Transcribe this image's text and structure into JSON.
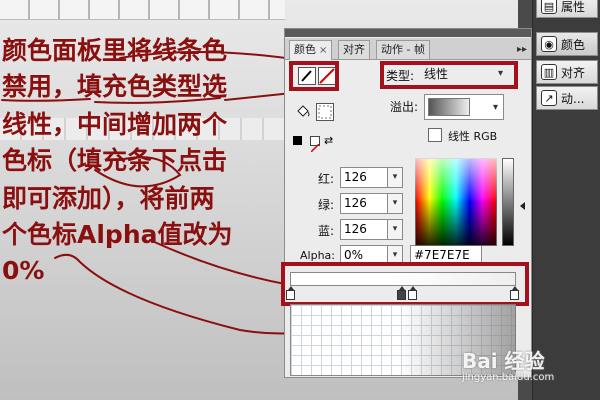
{
  "annotation": {
    "lines": [
      "颜色面板里将线条色",
      "禁用，填充色类型选",
      "线性，中间增加两个",
      "色标（填充条下点击",
      "即可添加），将前两",
      "个色标Alpha值改为",
      "0%"
    ],
    "color": "#8a0f0f"
  },
  "dock": {
    "items": [
      {
        "label": "属性",
        "icon": "properties-icon"
      },
      {
        "label": "颜色",
        "icon": "color-palette-icon"
      },
      {
        "label": "对齐",
        "icon": "align-icon"
      },
      {
        "label": "动...",
        "icon": "motion-icon"
      }
    ]
  },
  "panel": {
    "tabs": [
      {
        "label": "颜色",
        "close": "×"
      },
      {
        "label": "对齐"
      },
      {
        "label": "动作 - 帧"
      }
    ],
    "menu_glyph": "▸▸",
    "type_label": "类型:",
    "type_value": "线性",
    "overflow_label": "溢出:",
    "linear_rgb_label": "线性 RGB",
    "red_label": "红:",
    "green_label": "绿:",
    "blue_label": "蓝:",
    "alpha_label": "Alpha:",
    "red_value": "126",
    "green_value": "126",
    "blue_value": "126",
    "alpha_value": "0%",
    "hex_value": "#7E7E7E"
  },
  "watermark": {
    "main": "Bai 经验",
    "sub": "jingyan.baidu.com"
  },
  "colors": {
    "highlight_box": "#a3121c",
    "dock_bg": "#3c3c3c",
    "panel_bg": "#ececec"
  }
}
